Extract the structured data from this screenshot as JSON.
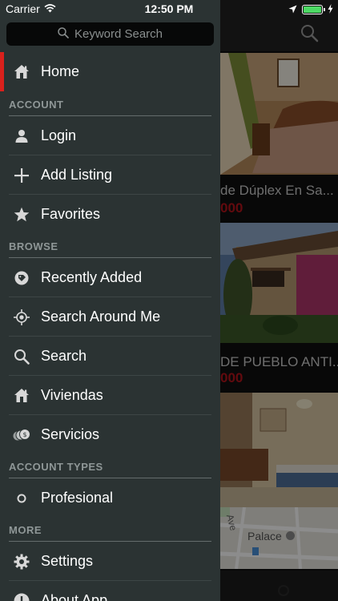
{
  "status_bar": {
    "carrier": "Carrier",
    "time": "12:50 PM",
    "battery_level": 0.9
  },
  "search": {
    "placeholder": "Keyword Search"
  },
  "menu": {
    "home": "Home",
    "account_header": "ACCOUNT",
    "login": "Login",
    "add_listing": "Add Listing",
    "favorites": "Favorites",
    "browse_header": "BROWSE",
    "recently_added": "Recently Added",
    "search_around_me": "Search Around Me",
    "search": "Search",
    "viviendas": "Viviendas",
    "servicios": "Servicios",
    "account_types_header": "ACCOUNT TYPES",
    "profesional": "Profesional",
    "more_header": "MORE",
    "settings": "Settings",
    "about_app": "About App"
  },
  "listings": [
    {
      "caption": "de Dúplex En Sa...",
      "price": "000"
    },
    {
      "caption": "DE PUEBLO ANTI...",
      "price": "000"
    }
  ],
  "map": {
    "poi_label": "Palace",
    "street_label": "Ave"
  },
  "colors": {
    "accent": "#d9211c",
    "drawer_bg": "#2b3333",
    "price": "#b3131b"
  }
}
